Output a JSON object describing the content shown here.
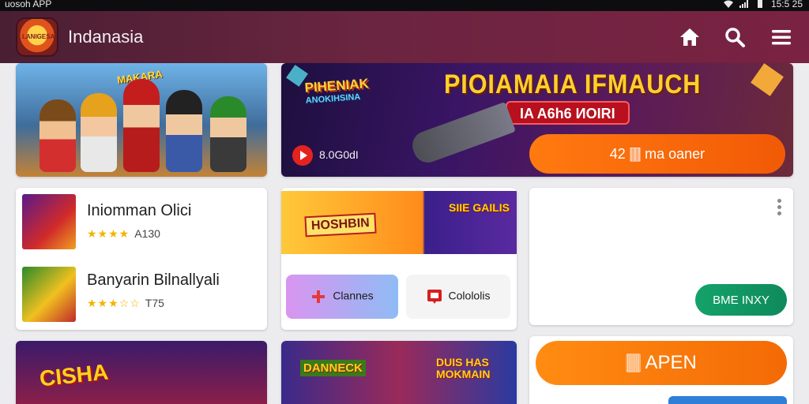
{
  "status_bar": {
    "left_text": "uosoh APP",
    "time": "15:5 25"
  },
  "app_bar": {
    "title": "Indanasia",
    "logo_text": "LANIGESA"
  },
  "hero_left": {
    "title": "MAKARA"
  },
  "hero_banner": {
    "logo_line1": "PIHENIAK",
    "logo_line2": "ANOKIHSINA",
    "headline": "PIOIAMAIA IFMAUCH",
    "tag": "IA A6h6 ИOIRI",
    "count": "8.0G0dI",
    "cta_label": "42 🀫 ma oaner"
  },
  "list_items": [
    {
      "title": "Iniomman Olici",
      "stars": "★★★★",
      "rating_text": "A130"
    },
    {
      "title": "Banyarin Bilnallyali",
      "stars": "★★★☆☆",
      "rating_text": "T75"
    }
  ],
  "promo": {
    "logo_left": "HOSHBIN",
    "logo_right": "SIIE GAILIS",
    "button1_label": "Clannes",
    "button2_label": "Colololis"
  },
  "side_card": {
    "button_label": "BME INXY"
  },
  "bottom_left": {
    "logo": "CISHA"
  },
  "bottom_mid": {
    "logo_left": "DANNECK",
    "logo_right": "DUIS HAS MOKMAIN"
  },
  "bottom_right": {
    "button_label": "🀫 APEN"
  },
  "colors": {
    "app_bar": "#6b2540",
    "orange_cta": "#f46a06",
    "green_button": "#14a26a",
    "star": "#f2b400"
  },
  "icons": [
    "home-icon",
    "search-icon",
    "menu-icon",
    "play-icon",
    "kebab-icon"
  ]
}
